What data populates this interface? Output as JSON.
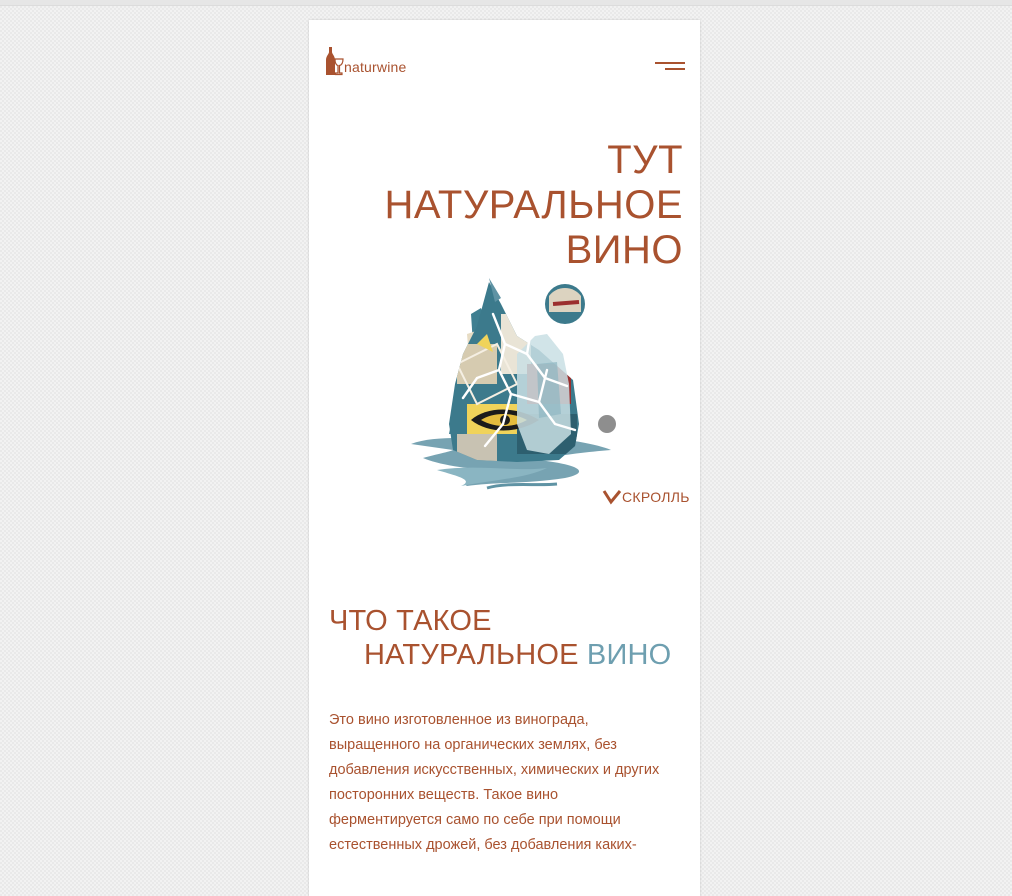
{
  "brand": {
    "name": "naturwine",
    "color": "#a9522f",
    "accent_color": "#6e9fb0"
  },
  "header": {
    "logo_icon": "bottle-glass-icon",
    "menu_icon": "hamburger-menu-icon"
  },
  "hero": {
    "title_lines": [
      "ТУТ",
      "НАТУРАЛЬНОЕ",
      "ВИНО"
    ],
    "art_icon": "collage-illustration",
    "scroll_label": "СКРОЛЛЬ",
    "scroll_icon": "chevron-down-icon"
  },
  "section": {
    "title_part1": "ЧТО ТАКОЕ",
    "title_part2": "НАТУРАЛЬНОЕ",
    "title_accent": "ВИНО",
    "intro": "Это вино изготовленное из винограда, выращенного на органических землях, без добавления искусственных, химических и других посторонних веществ. Такое вино ферментируется само по себе при помощи естественных дрожей, без добавления каких-"
  }
}
